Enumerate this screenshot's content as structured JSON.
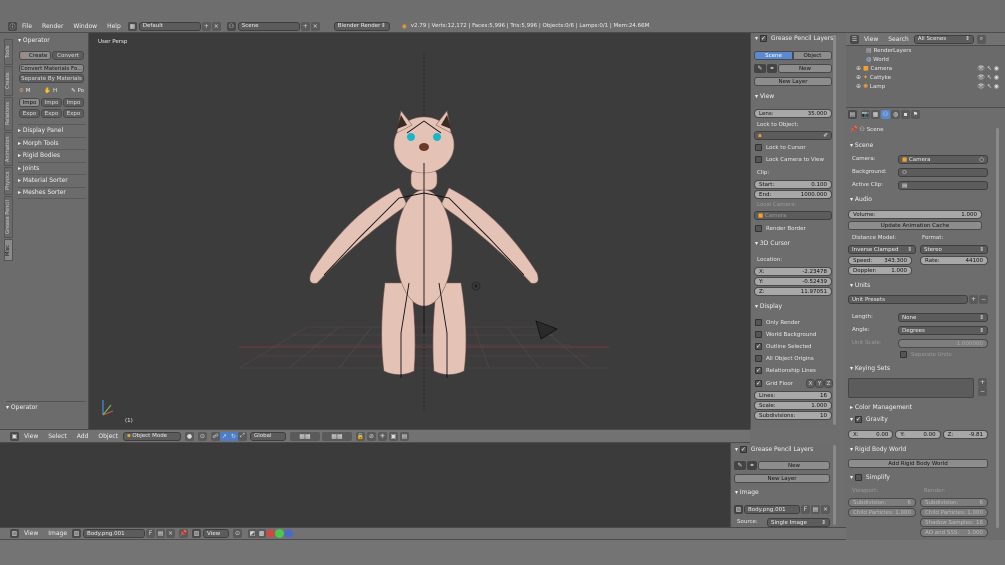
{
  "top_menu": {
    "items": [
      "File",
      "Render",
      "Window",
      "Help"
    ],
    "layout": "Default",
    "scene": "Scene",
    "engine": "Blender Render",
    "status": "v2.79 | Verts:12,172 | Faces:5,996 | Tris:5,996 | Objects:0/6 | Lamps:0/1 | Mem:24.66M"
  },
  "toolshelf": {
    "tabs": [
      "Tools",
      "Create",
      "Relations",
      "Animation",
      "Physics",
      "Grease Pencil",
      "Misc"
    ],
    "operator_header": "Operator",
    "create_label": "Create",
    "convert_label": "Convert",
    "convert_materials": "Convert Materials Fo...",
    "separate_materials": "Separate By Materials",
    "small_buttons_row1": [
      "M",
      "H",
      "Po"
    ],
    "small_buttons_row2": [
      "Impo",
      "Impo",
      "Impo"
    ],
    "small_buttons_row3": [
      "Expo",
      "Expo",
      "Expo"
    ],
    "panels": [
      "Display Panel",
      "Morph Tools",
      "Rigid Bodies",
      "Joints",
      "Material Sorter",
      "Meshes Sorter"
    ],
    "bottom_operator": "Operator"
  },
  "viewport": {
    "label": "User Persp",
    "frame": "(1)"
  },
  "view3d_header": {
    "menus": [
      "View",
      "Select",
      "Add",
      "Object"
    ],
    "mode": "Object Mode",
    "orientation": "Global"
  },
  "n_panel": {
    "gp_title": "Grease Pencil Layers",
    "gp_tabs": [
      "Scene",
      "Object"
    ],
    "new_label": "New",
    "new_layer": "New Layer",
    "view_title": "View",
    "lens_label": "Lens:",
    "lens_value": "35.000",
    "lock_to_object": "Lock to Object:",
    "lock_cursor": "Lock to Cursor",
    "lock_camera": "Lock Camera to View",
    "clip_label": "Clip:",
    "clip_start_label": "Start:",
    "clip_start": "0.100",
    "clip_end_label": "End:",
    "clip_end": "1000.000",
    "local_camera": "Local Camera:",
    "camera_field": "Camera",
    "render_border": "Render Border",
    "cursor_title": "3D Cursor",
    "location_label": "Location:",
    "cursor_x_label": "X:",
    "cursor_x": "-2.23478",
    "cursor_y_label": "Y:",
    "cursor_y": "-0.52439",
    "cursor_z_label": "Z:",
    "cursor_z": "11.97051",
    "display_title": "Display",
    "display_items": [
      {
        "label": "Only Render",
        "checked": false
      },
      {
        "label": "World Background",
        "checked": false
      },
      {
        "label": "Outline Selected",
        "checked": true
      },
      {
        "label": "All Object Origins",
        "checked": false
      },
      {
        "label": "Relationship Lines",
        "checked": true
      }
    ],
    "grid_floor": "Grid Floor",
    "grid_axes": [
      "X",
      "Y",
      "Z"
    ],
    "lines_label": "Lines:",
    "lines_value": "16",
    "scale_label": "Scale:",
    "scale_value": "1.000",
    "subdiv_label": "Subdivisions:",
    "subdiv_value": "10"
  },
  "outliner": {
    "menus": [
      "View",
      "Search"
    ],
    "filter": "All Scenes",
    "items": [
      "RenderLayers",
      "World",
      "Camera",
      "Cattyke",
      "Lamp"
    ]
  },
  "properties": {
    "breadcrumb": "Scene",
    "scene_title": "Scene",
    "camera_label": "Camera:",
    "camera_value": "Camera",
    "background_label": "Background:",
    "active_clip_label": "Active Clip:",
    "audio_title": "Audio",
    "volume_label": "Volume:",
    "volume_value": "1.000",
    "update_cache": "Update Animation Cache",
    "distance_model": "Distance Model:",
    "format_label": "Format:",
    "distance_value": "Inverse Clamped",
    "format_value": "Stereo",
    "speed_label": "Speed:",
    "speed_value": "343.300",
    "rate_label": "Rate:",
    "rate_value": "44100",
    "doppler_label": "Doppler:",
    "doppler_value": "1.000",
    "units_title": "Units",
    "unit_presets": "Unit Presets",
    "length_label": "Length:",
    "length_value": "None",
    "angle_label": "Angle:",
    "angle_value": "Degrees",
    "unit_scale_label": "Unit Scale:",
    "unit_scale_value": "1.000000",
    "separate_units": "Separate Units",
    "keying_title": "Keying Sets",
    "color_mgmt": "Color Management",
    "gravity_title": "Gravity",
    "gx_label": "X:",
    "gx": "0.00",
    "gy_label": "Y:",
    "gy": "0.00",
    "gz_label": "Z:",
    "gz": "-9.81",
    "rigid_title": "Rigid Body World",
    "add_rigid": "Add Rigid Body World",
    "simplify_title": "Simplify",
    "viewport_label": "Viewport:",
    "render_label": "Render:",
    "subdivision_label": "Subdivision:",
    "subdivision_viewport": "6",
    "subdivision_render": "6",
    "child_particles_label": "Child Particles:",
    "child_particles_viewport": "1.000",
    "child_particles_render": "1.000",
    "shadow_samples_label": "Shadow Samples:",
    "shadow_samples": "16",
    "ao_sss_label": "AO and SSS:",
    "ao_sss": "1.000"
  },
  "image_editor": {
    "gp_title": "Grease Pencil Layers",
    "new_label": "New",
    "new_layer": "New Layer",
    "image_title": "Image",
    "image_name": "Body.png.001",
    "source_label": "Source:",
    "source_value": "Single Image",
    "menus": [
      "View",
      "Image"
    ],
    "header_image": "Body.png.001",
    "view_dropdown": "View"
  }
}
